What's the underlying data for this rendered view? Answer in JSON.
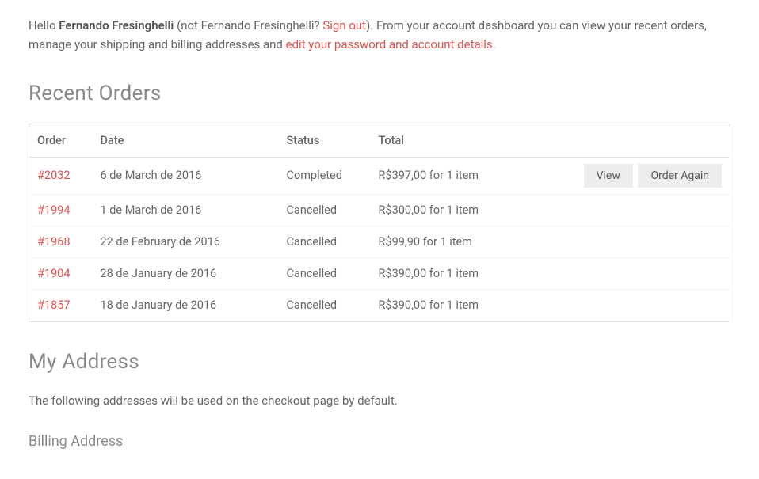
{
  "intro": {
    "hello": "Hello",
    "user_name": "Fernando Fresinghelli",
    "not_prefix": "(not Fernando Fresinghelli? ",
    "signout_label": "Sign out",
    "not_suffix": "). From your account dashboard you can view your recent orders, manage your shipping and billing addresses and ",
    "edit_link_label": "edit your password and account details",
    "period": "."
  },
  "recent_orders": {
    "heading": "Recent Orders",
    "headers": {
      "order": "Order",
      "date": "Date",
      "status": "Status",
      "total": "Total"
    },
    "rows": [
      {
        "order": "#2032",
        "date": "6 de March de 2016",
        "status": "Completed",
        "total": "R$397,00 for 1 item",
        "actions": {
          "view": "View",
          "order_again": "Order Again"
        }
      },
      {
        "order": "#1994",
        "date": "1 de March de 2016",
        "status": "Cancelled",
        "total": "R$300,00 for 1 item"
      },
      {
        "order": "#1968",
        "date": "22 de February de 2016",
        "status": "Cancelled",
        "total": "R$99,90 for 1 item"
      },
      {
        "order": "#1904",
        "date": "28 de January de 2016",
        "status": "Cancelled",
        "total": "R$390,00 for 1 item"
      },
      {
        "order": "#1857",
        "date": "18 de January de 2016",
        "status": "Cancelled",
        "total": "R$390,00 for 1 item"
      }
    ]
  },
  "address_section": {
    "heading": "My Address",
    "intro": "The following addresses will be used on the checkout page by default.",
    "billing_heading": "Billing Address"
  }
}
